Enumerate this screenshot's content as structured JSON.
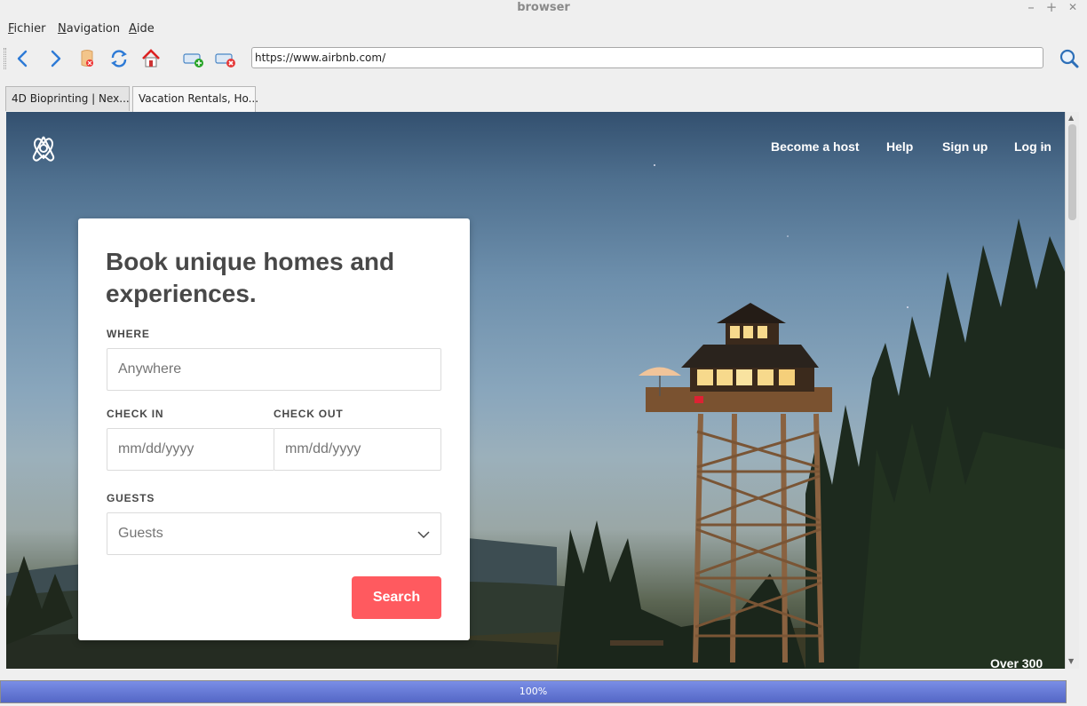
{
  "window": {
    "title": "browser",
    "controls": {
      "minimize": "–",
      "maximize": "+",
      "close": "✕"
    }
  },
  "menubar": {
    "items": [
      {
        "label": "Fichier",
        "accel": "F"
      },
      {
        "label": "Navigation",
        "accel": "N"
      },
      {
        "label": "Aide",
        "accel": "A"
      }
    ]
  },
  "toolbar": {
    "icons": [
      "back-icon",
      "forward-icon",
      "stop-icon",
      "reload-icon",
      "home-icon",
      "new-tab-icon",
      "close-tab-icon"
    ],
    "url": "https://www.airbnb.com/",
    "search_icon": "search-icon"
  },
  "tabs": [
    {
      "label": "4D Bioprinting | Nex...",
      "active": false
    },
    {
      "label": "Vacation Rentals, Ho...",
      "active": true
    }
  ],
  "page": {
    "nav": {
      "become_host": "Become a host",
      "help": "Help",
      "sign_up": "Sign up",
      "log_in": "Log in"
    },
    "card": {
      "heading": "Book unique homes and experiences.",
      "where_label": "WHERE",
      "where_placeholder": "Anywhere",
      "checkin_label": "CHECK IN",
      "checkin_placeholder": "mm/dd/yyyy",
      "checkout_label": "CHECK OUT",
      "checkout_placeholder": "mm/dd/yyyy",
      "guests_label": "GUESTS",
      "guests_value": "Guests",
      "search_label": "Search"
    },
    "corner_text": "Over 300",
    "brand_color": "#ff5a5f"
  },
  "status": {
    "progress_text": "100%",
    "progress": 1.0
  }
}
